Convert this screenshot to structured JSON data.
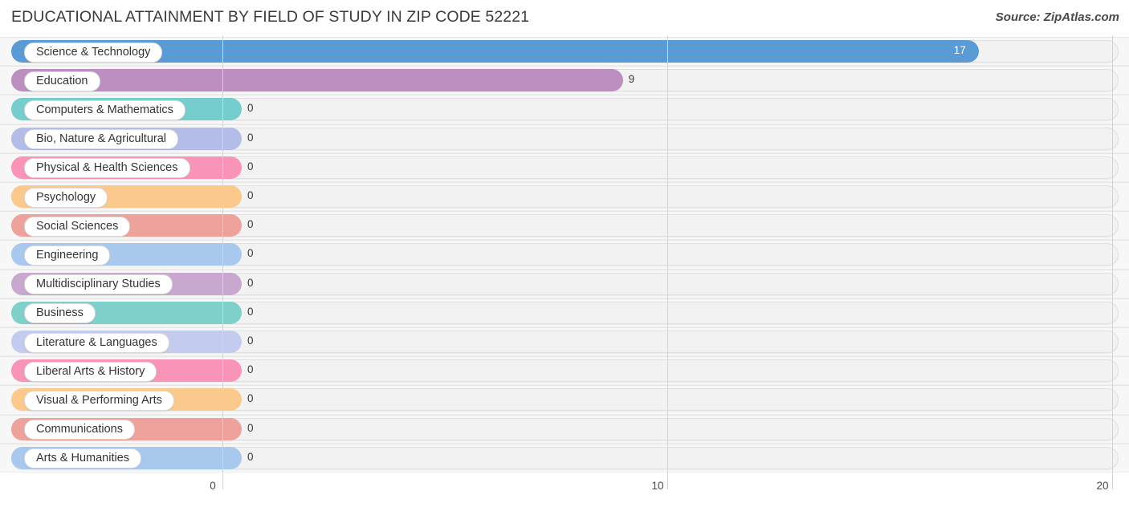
{
  "header": {
    "title": "EDUCATIONAL ATTAINMENT BY FIELD OF STUDY IN ZIP CODE 52221",
    "source": "Source: ZipAtlas.com"
  },
  "chart_data": {
    "type": "bar",
    "orientation": "horizontal",
    "title": "EDUCATIONAL ATTAINMENT BY FIELD OF STUDY IN ZIP CODE 52221",
    "xlabel": "",
    "ylabel": "",
    "xlim": [
      0,
      20
    ],
    "xticks": [
      0,
      10,
      20
    ],
    "xtick_labels": [
      "0",
      "10",
      "20"
    ],
    "grid": true,
    "legend": "none",
    "categories": [
      "Science & Technology",
      "Education",
      "Computers & Mathematics",
      "Bio, Nature & Agricultural",
      "Physical & Health Sciences",
      "Psychology",
      "Social Sciences",
      "Engineering",
      "Multidisciplinary Studies",
      "Business",
      "Literature & Languages",
      "Liberal Arts & History",
      "Visual & Performing Arts",
      "Communications",
      "Arts & Humanities"
    ],
    "values": [
      17,
      9,
      0,
      0,
      0,
      0,
      0,
      0,
      0,
      0,
      0,
      0,
      0,
      0,
      0
    ],
    "value_labels": [
      "17",
      "9",
      "0",
      "0",
      "0",
      "0",
      "0",
      "0",
      "0",
      "0",
      "0",
      "0",
      "0",
      "0",
      "0"
    ],
    "bar_colors": [
      "#5b9bd5",
      "#bc8fc0",
      "#76cdcd",
      "#b4bde8",
      "#f993b8",
      "#fbc98b",
      "#eda29b",
      "#a9c8ee",
      "#c8a8ce",
      "#7fcfcb",
      "#c3cbef",
      "#f993b8",
      "#fbc98b",
      "#eda29b",
      "#a9c8ee"
    ]
  }
}
